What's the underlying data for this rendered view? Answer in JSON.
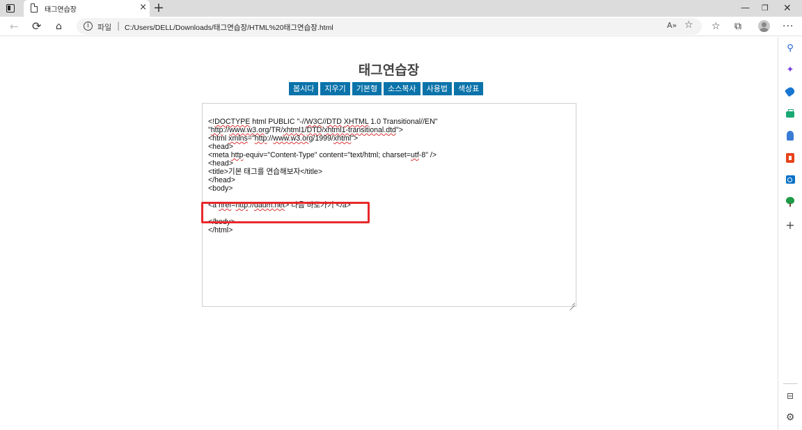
{
  "browser": {
    "tab_title": "태그연습장",
    "tab_close": "×",
    "new_tab": "+",
    "window_controls": {
      "minimize": "—",
      "restore": "❐",
      "close": "✕"
    },
    "nav": {
      "back": "←",
      "reload": "⟳",
      "home": "⌂"
    },
    "address": {
      "info": "i",
      "scheme": "파일",
      "separator": "|",
      "url": "C:/Users/DELL/Downloads/태그연습장/HTML%20태그연습장.html"
    },
    "read_aloud": "A»",
    "favorite_star": "☆",
    "favorites": "☆",
    "collections": "⧉",
    "more": "···"
  },
  "sidebar": {
    "search": "⚲",
    "copilot": "✦",
    "add": "+",
    "layout": "⊟",
    "settings": "⚙"
  },
  "page": {
    "title": "태그연습장",
    "buttons": [
      "봅시다",
      "지우기",
      "기본형",
      "소스복사",
      "사용법",
      "색상표"
    ]
  },
  "editor": {
    "lines": [
      {
        "parts": [
          {
            "t": "<!"
          },
          {
            "t": "DOCTYPE",
            "sq": true
          },
          {
            "t": " html PUBLIC \"-//"
          },
          {
            "t": "W3C",
            "sq": true
          },
          {
            "t": "//"
          },
          {
            "t": "DTD",
            "sq": true
          },
          {
            "t": " "
          },
          {
            "t": "XHTML",
            "sq": true
          },
          {
            "t": " 1.0 Transitional//EN\""
          }
        ]
      },
      {
        "parts": [
          {
            "t": "\""
          },
          {
            "t": "http",
            "sq": true
          },
          {
            "t": "://"
          },
          {
            "t": "www.w3.org",
            "sq": true
          },
          {
            "t": "/TR/"
          },
          {
            "t": "xhtml1",
            "sq": true
          },
          {
            "t": "/"
          },
          {
            "t": "DTD",
            "sq": true
          },
          {
            "t": "/"
          },
          {
            "t": "xhtml1-transitional.dtd",
            "sq": true
          },
          {
            "t": "\">"
          }
        ]
      },
      {
        "parts": [
          {
            "t": "<html "
          },
          {
            "t": "xmlns",
            "sq": true
          },
          {
            "t": "=\""
          },
          {
            "t": "http",
            "sq": true
          },
          {
            "t": "://"
          },
          {
            "t": "www.w3.org",
            "sq": true
          },
          {
            "t": "/1999/"
          },
          {
            "t": "xhtml",
            "sq": true
          },
          {
            "t": "\">"
          }
        ]
      },
      {
        "parts": [
          {
            "t": "<head>"
          }
        ]
      },
      {
        "parts": [
          {
            "t": "<meta "
          },
          {
            "t": "http",
            "sq": true
          },
          {
            "t": "-equiv=\"Content-Type\" content=\"text/html; charset="
          },
          {
            "t": "utf",
            "sq": true
          },
          {
            "t": "-8\" />"
          }
        ]
      },
      {
        "parts": [
          {
            "t": "<head>"
          }
        ]
      },
      {
        "parts": [
          {
            "t": "<title>기본 태그를 연습해보자</title>"
          }
        ]
      },
      {
        "parts": [
          {
            "t": "</head>"
          }
        ]
      },
      {
        "parts": [
          {
            "t": "<body>"
          }
        ]
      },
      {
        "parts": [
          {
            "t": ""
          }
        ]
      },
      {
        "parts": [
          {
            "t": "<a "
          },
          {
            "t": "href",
            "sq": true
          },
          {
            "t": "="
          },
          {
            "t": "http",
            "sq": true
          },
          {
            "t": "://"
          },
          {
            "t": "daum.net",
            "sq": true
          },
          {
            "t": "> 다음 바로가기 </a>"
          }
        ]
      },
      {
        "parts": [
          {
            "t": ""
          }
        ]
      },
      {
        "parts": [
          {
            "t": "</body>"
          }
        ]
      },
      {
        "parts": [
          {
            "t": "</html>"
          }
        ]
      }
    ]
  }
}
